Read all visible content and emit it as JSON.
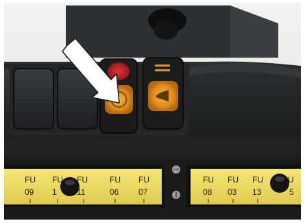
{
  "scene": {
    "subject": "Vehicle dashboard switch panel with fuse label strips",
    "arrow_icon": "white-arrow-icon",
    "colors": {
      "fuse_label": "#e9d64a",
      "panel": "#1e2022",
      "amber_switch": "#e08a1c",
      "red_switch": "#c21e22",
      "arrow": "#ffffff"
    }
  },
  "fuse_strip_left": {
    "labels": [
      {
        "top": "FU",
        "num": "09"
      },
      {
        "top": "FU",
        "num": "1"
      },
      {
        "top": "FU",
        "num": "11"
      },
      {
        "top": "FU",
        "num": "06"
      },
      {
        "top": "FU",
        "num": "07"
      }
    ]
  },
  "fuse_strip_right": {
    "labels": [
      {
        "top": "FU",
        "num": "08"
      },
      {
        "top": "FU",
        "num": "03"
      },
      {
        "top": "FU",
        "num": "13"
      },
      {
        "top": "U",
        "num": "5"
      }
    ]
  }
}
